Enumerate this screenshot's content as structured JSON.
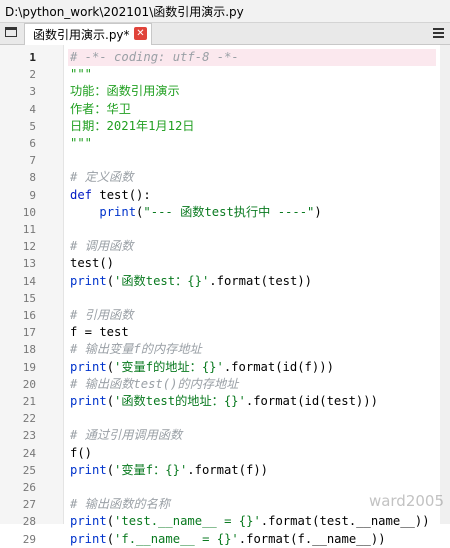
{
  "window": {
    "title": "D:\\python_work\\202101\\函数引用演示.py"
  },
  "tabs": [
    {
      "label": "函数引用演示.py*",
      "close": "✕"
    }
  ],
  "editor": {
    "active_line": 1,
    "lines": [
      {
        "n": "1",
        "t": [
          [
            "cm",
            "# -*- coding: utf-8 -*-"
          ]
        ]
      },
      {
        "n": "2",
        "t": [
          [
            "doc",
            "\"\"\""
          ]
        ]
      },
      {
        "n": "3",
        "t": [
          [
            "doc",
            "功能：函数引用演示"
          ]
        ]
      },
      {
        "n": "4",
        "t": [
          [
            "doc",
            "作者：华卫"
          ]
        ]
      },
      {
        "n": "5",
        "t": [
          [
            "doc",
            "日期：2021年1月12日"
          ]
        ]
      },
      {
        "n": "6",
        "t": [
          [
            "doc",
            "\"\"\""
          ]
        ]
      },
      {
        "n": "7",
        "t": []
      },
      {
        "n": "8",
        "t": [
          [
            "cm",
            "# 定义函数"
          ]
        ]
      },
      {
        "n": "9",
        "t": [
          [
            "kw",
            "def "
          ],
          [
            "fn",
            "test():"
          ]
        ]
      },
      {
        "n": "10",
        "t": [
          [
            "",
            "    "
          ],
          [
            "bi",
            "print"
          ],
          [
            "",
            "("
          ],
          [
            "str",
            "\"--- 函数test执行中 ----\""
          ],
          [
            "",
            ")"
          ]
        ]
      },
      {
        "n": "11",
        "t": []
      },
      {
        "n": "12",
        "t": [
          [
            "cm",
            "# 调用函数"
          ]
        ]
      },
      {
        "n": "13",
        "t": [
          [
            "",
            "test()"
          ]
        ]
      },
      {
        "n": "14",
        "t": [
          [
            "bi",
            "print"
          ],
          [
            "",
            "("
          ],
          [
            "str",
            "'函数test：{}'"
          ],
          [
            "",
            ".format(test))"
          ]
        ]
      },
      {
        "n": "15",
        "t": []
      },
      {
        "n": "16",
        "t": [
          [
            "cm",
            "# 引用函数"
          ]
        ]
      },
      {
        "n": "17",
        "t": [
          [
            "",
            "f = test"
          ]
        ]
      },
      {
        "n": "18",
        "t": [
          [
            "cm",
            "# 输出变量f的内存地址"
          ]
        ]
      },
      {
        "n": "19",
        "t": [
          [
            "bi",
            "print"
          ],
          [
            "",
            "("
          ],
          [
            "str",
            "'变量f的地址：{}'"
          ],
          [
            "",
            ".format(id(f)))"
          ]
        ]
      },
      {
        "n": "20",
        "t": [
          [
            "cm",
            "# 输出函数test()的内存地址"
          ]
        ]
      },
      {
        "n": "21",
        "t": [
          [
            "bi",
            "print"
          ],
          [
            "",
            "("
          ],
          [
            "str",
            "'函数test的地址：{}'"
          ],
          [
            "",
            ".format(id(test)))"
          ]
        ]
      },
      {
        "n": "22",
        "t": []
      },
      {
        "n": "23",
        "t": [
          [
            "cm",
            "# 通过引用调用函数"
          ]
        ]
      },
      {
        "n": "24",
        "t": [
          [
            "",
            "f()"
          ]
        ]
      },
      {
        "n": "25",
        "t": [
          [
            "bi",
            "print"
          ],
          [
            "",
            "("
          ],
          [
            "str",
            "'变量f：{}'"
          ],
          [
            "",
            ".format(f))"
          ]
        ]
      },
      {
        "n": "26",
        "t": []
      },
      {
        "n": "27",
        "t": [
          [
            "cm",
            "# 输出函数的名称"
          ]
        ]
      },
      {
        "n": "28",
        "t": [
          [
            "bi",
            "print"
          ],
          [
            "",
            "("
          ],
          [
            "str",
            "'test.__name__ = {}'"
          ],
          [
            "",
            ".format(test.__name__))"
          ]
        ]
      },
      {
        "n": "29",
        "t": [
          [
            "bi",
            "print"
          ],
          [
            "",
            "("
          ],
          [
            "str",
            "'f.__name__ = {}'"
          ],
          [
            "",
            ".format(f.__name__))"
          ]
        ]
      }
    ]
  },
  "watermark": "ward2005"
}
